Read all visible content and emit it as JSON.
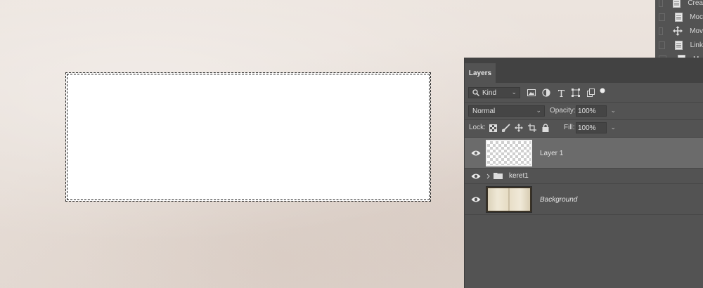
{
  "history": {
    "items": [
      {
        "label": "Crea",
        "icon": "document-icon"
      },
      {
        "label": "Moc",
        "icon": "document-icon"
      },
      {
        "label": "Mov",
        "icon": "move-icon"
      },
      {
        "label": "Link",
        "icon": "document-icon"
      },
      {
        "label": "M",
        "icon": "document-icon"
      }
    ]
  },
  "layers_panel": {
    "tab_label": "Layers",
    "filter": {
      "kind_label": "Kind"
    },
    "blend_mode": "Normal",
    "opacity_label": "Opacity:",
    "opacity_value": "100%",
    "lock_label": "Lock:",
    "fill_label": "Fill:",
    "fill_value": "100%",
    "layers": [
      {
        "name": "Layer 1",
        "selected": true
      },
      {
        "name": "keret1",
        "type": "group"
      },
      {
        "name": "Background",
        "italic": true
      }
    ]
  }
}
